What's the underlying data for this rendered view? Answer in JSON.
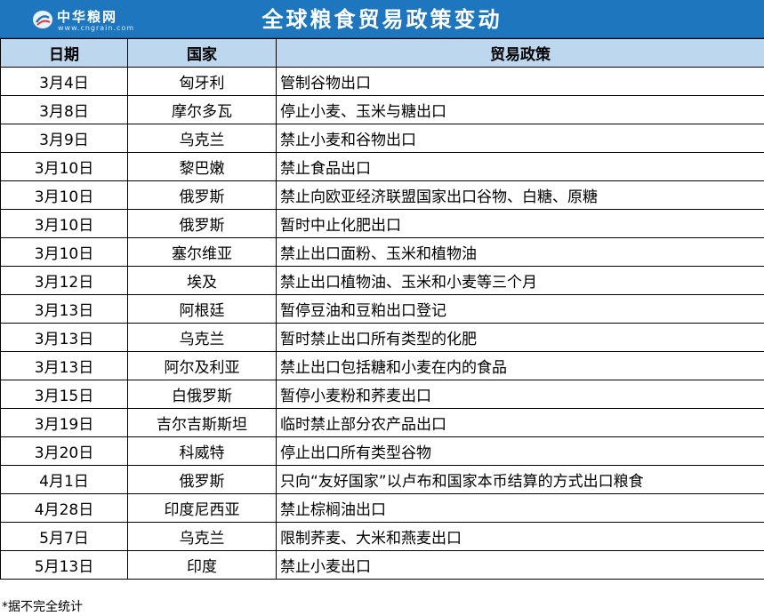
{
  "header": {
    "logo_name": "中华粮网",
    "logo_url": "www.cngrain.com",
    "title": "全球粮食贸易政策变动"
  },
  "colors": {
    "title_bg": "#1e76be",
    "header_row_bg": "#bdd7ee"
  },
  "table": {
    "columns": [
      "日期",
      "国家",
      "贸易政策"
    ],
    "rows": [
      {
        "date": "3月4日",
        "country": "匈牙利",
        "policy": "管制谷物出口"
      },
      {
        "date": "3月8日",
        "country": "摩尔多瓦",
        "policy": "停止小麦、玉米与糖出口"
      },
      {
        "date": "3月9日",
        "country": "乌克兰",
        "policy": "禁止小麦和谷物出口"
      },
      {
        "date": "3月10日",
        "country": "黎巴嫩",
        "policy": "禁止食品出口"
      },
      {
        "date": "3月10日",
        "country": "俄罗斯",
        "policy": "禁止向欧亚经济联盟国家出口谷物、白糖、原糖"
      },
      {
        "date": "3月10日",
        "country": "俄罗斯",
        "policy": "暂时中止化肥出口"
      },
      {
        "date": "3月10日",
        "country": "塞尔维亚",
        "policy": "禁止出口面粉、玉米和植物油"
      },
      {
        "date": "3月12日",
        "country": "埃及",
        "policy": "禁止出口植物油、玉米和小麦等三个月"
      },
      {
        "date": "3月13日",
        "country": "阿根廷",
        "policy": "暂停豆油和豆粕出口登记"
      },
      {
        "date": "3月13日",
        "country": "乌克兰",
        "policy": "暂时禁止出口所有类型的化肥"
      },
      {
        "date": "3月13日",
        "country": "阿尔及利亚",
        "policy": "禁止出口包括糖和小麦在内的食品"
      },
      {
        "date": "3月15日",
        "country": "白俄罗斯",
        "policy": "暂停小麦粉和荞麦出口"
      },
      {
        "date": "3月19日",
        "country": "吉尔吉斯斯坦",
        "policy": "临时禁止部分农产品出口"
      },
      {
        "date": "3月20日",
        "country": "科威特",
        "policy": "停止出口所有类型谷物"
      },
      {
        "date": "4月1日",
        "country": "俄罗斯",
        "policy": "只向“友好国家”以卢布和国家本币结算的方式出口粮食"
      },
      {
        "date": "4月28日",
        "country": "印度尼西亚",
        "policy": "禁止棕榈油出口"
      },
      {
        "date": "5月7日",
        "country": "乌克兰",
        "policy": "限制荞麦、大米和燕麦出口"
      },
      {
        "date": "5月13日",
        "country": "印度",
        "policy": "禁止小麦出口"
      }
    ]
  },
  "footnote": "*据不完全统计"
}
